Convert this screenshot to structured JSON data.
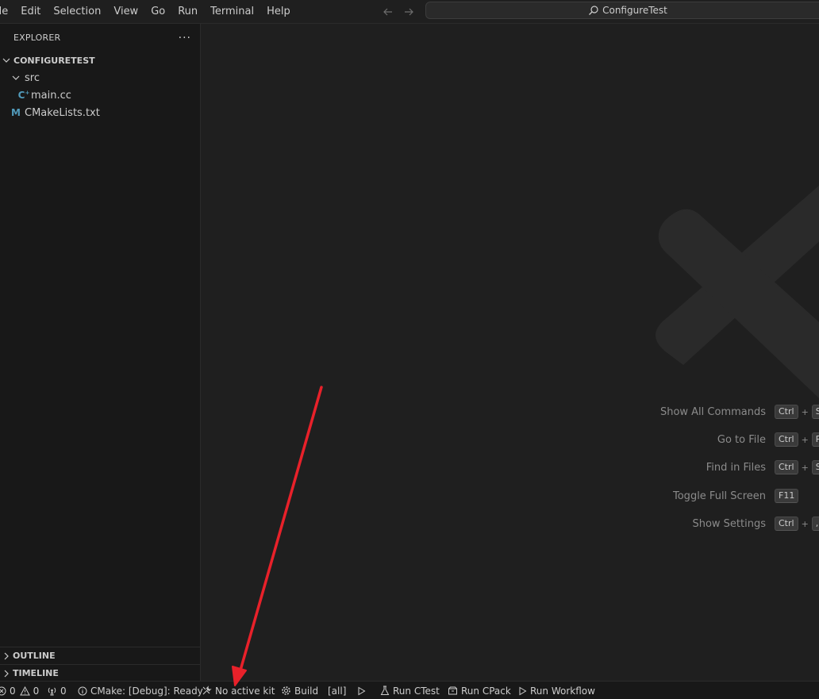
{
  "menu": [
    "ile",
    "Edit",
    "Selection",
    "View",
    "Go",
    "Run",
    "Terminal",
    "Help"
  ],
  "command_center": {
    "label": "ConfigureTest"
  },
  "explorer": {
    "title": "EXPLORER",
    "more": "···",
    "root": "CONFIGURETEST",
    "folder": "src",
    "files": {
      "main": "main.cc",
      "cmake": "CMakeLists.txt"
    }
  },
  "panels": {
    "outline": "OUTLINE",
    "timeline": "TIMELINE"
  },
  "shortcuts": [
    {
      "label": "Show All Commands",
      "keys": [
        "Ctrl",
        "+",
        "Sh"
      ]
    },
    {
      "label": "Go to File",
      "keys": [
        "Ctrl",
        "+",
        "P"
      ]
    },
    {
      "label": "Find in Files",
      "keys": [
        "Ctrl",
        "+",
        "Sh"
      ]
    },
    {
      "label": "Toggle Full Screen",
      "keys": [
        "F11"
      ]
    },
    {
      "label": "Show Settings",
      "keys": [
        "Ctrl",
        "+",
        ","
      ]
    }
  ],
  "status": {
    "errors": "0",
    "warnings": "0",
    "ports": "0",
    "cmake": "CMake: [Debug]: Ready",
    "kit": "No active kit",
    "build": "Build",
    "target": "[all]",
    "ctest": "Run CTest",
    "cpack": "Run CPack",
    "workflow": "Run Workflow"
  },
  "colors": {
    "annotation_arrow": "#e8212a",
    "accent": "#519aba"
  }
}
